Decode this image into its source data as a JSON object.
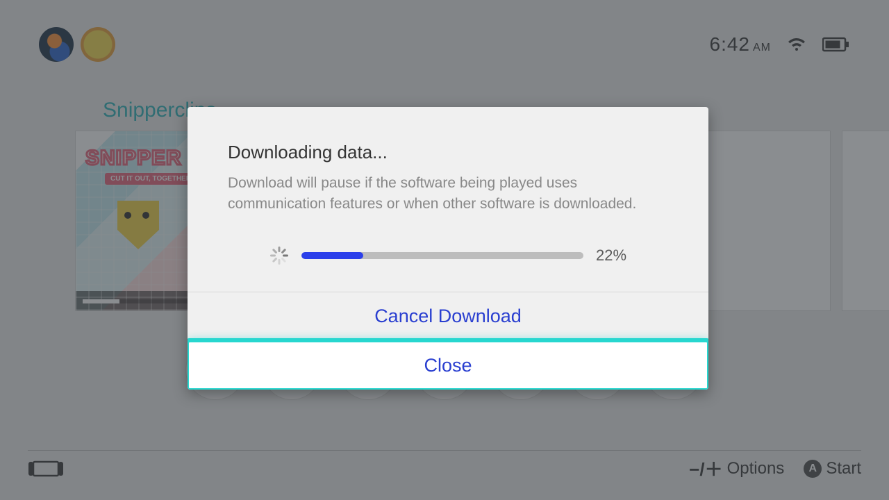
{
  "status": {
    "time": "6:42",
    "time_suffix": "AM"
  },
  "home": {
    "selected_game_title": "Snipperclips",
    "tile_logo_text": "SNIPPER",
    "tile_subtitle": "CUT IT OUT, TOGETHER!",
    "tile_download_fraction": 0.22
  },
  "dialog": {
    "title": "Downloading data...",
    "message": "Download will pause if the software being played uses communication features or when other software is downloaded.",
    "progress_percent": 22,
    "progress_label": "22%",
    "buttons": {
      "cancel": "Cancel Download",
      "close": "Close"
    }
  },
  "bottombar": {
    "options_label": "Options",
    "start_label": "Start",
    "a_glyph": "A"
  }
}
